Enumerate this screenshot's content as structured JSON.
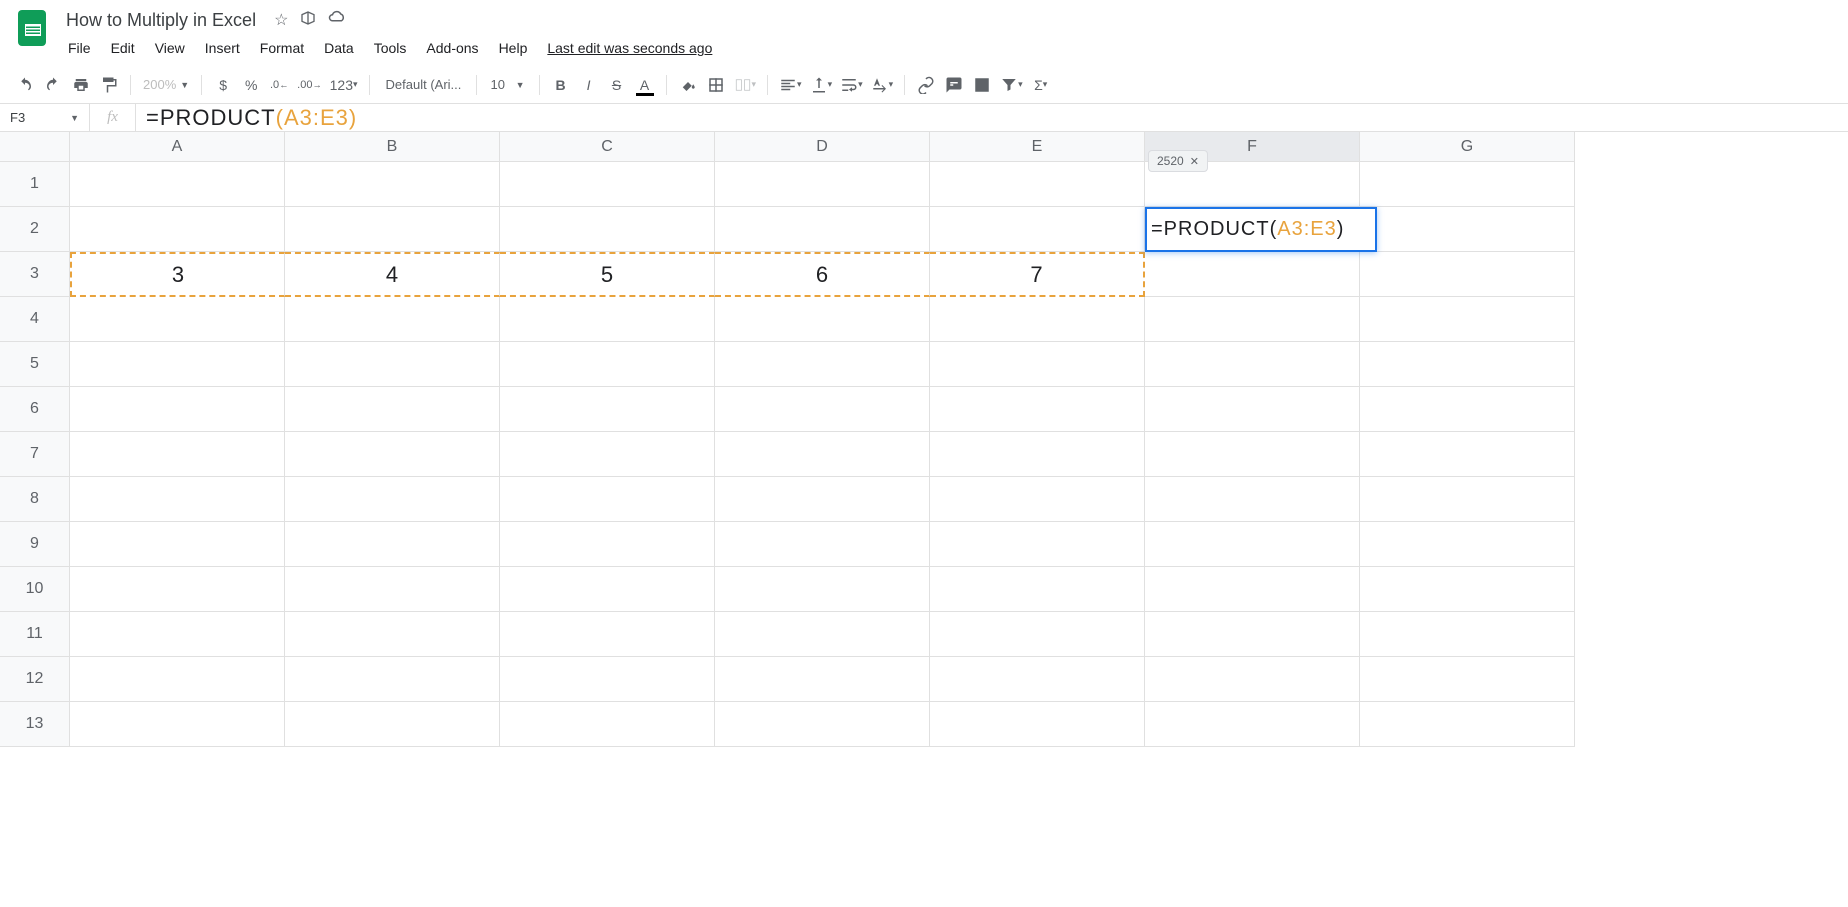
{
  "header": {
    "title": "How to Multiply in Excel",
    "menus": [
      "File",
      "Edit",
      "View",
      "Insert",
      "Format",
      "Data",
      "Tools",
      "Add-ons",
      "Help"
    ],
    "last_edit": "Last edit was seconds ago"
  },
  "toolbar": {
    "zoom": "200%",
    "font": "Default (Ari...",
    "font_size": "10",
    "number_format": "123"
  },
  "formula_bar": {
    "name_box": "F3",
    "fx": "fx",
    "formula_prefix": "=PRODUCT",
    "formula_open": "(",
    "formula_range": "A3:E3",
    "formula_close": ")"
  },
  "grid": {
    "columns": [
      "A",
      "B",
      "C",
      "D",
      "E",
      "F",
      "G"
    ],
    "rows": [
      "1",
      "2",
      "3",
      "4",
      "5",
      "6",
      "7",
      "8",
      "9",
      "10",
      "11",
      "12",
      "13"
    ],
    "row3": {
      "A": "3",
      "B": "4",
      "C": "5",
      "D": "6",
      "E": "7"
    }
  },
  "active_cell": {
    "formula_prefix": "=PRODUCT",
    "formula_open": "(",
    "formula_range": "A3:E3",
    "formula_close": ")",
    "result_preview": "2520"
  }
}
